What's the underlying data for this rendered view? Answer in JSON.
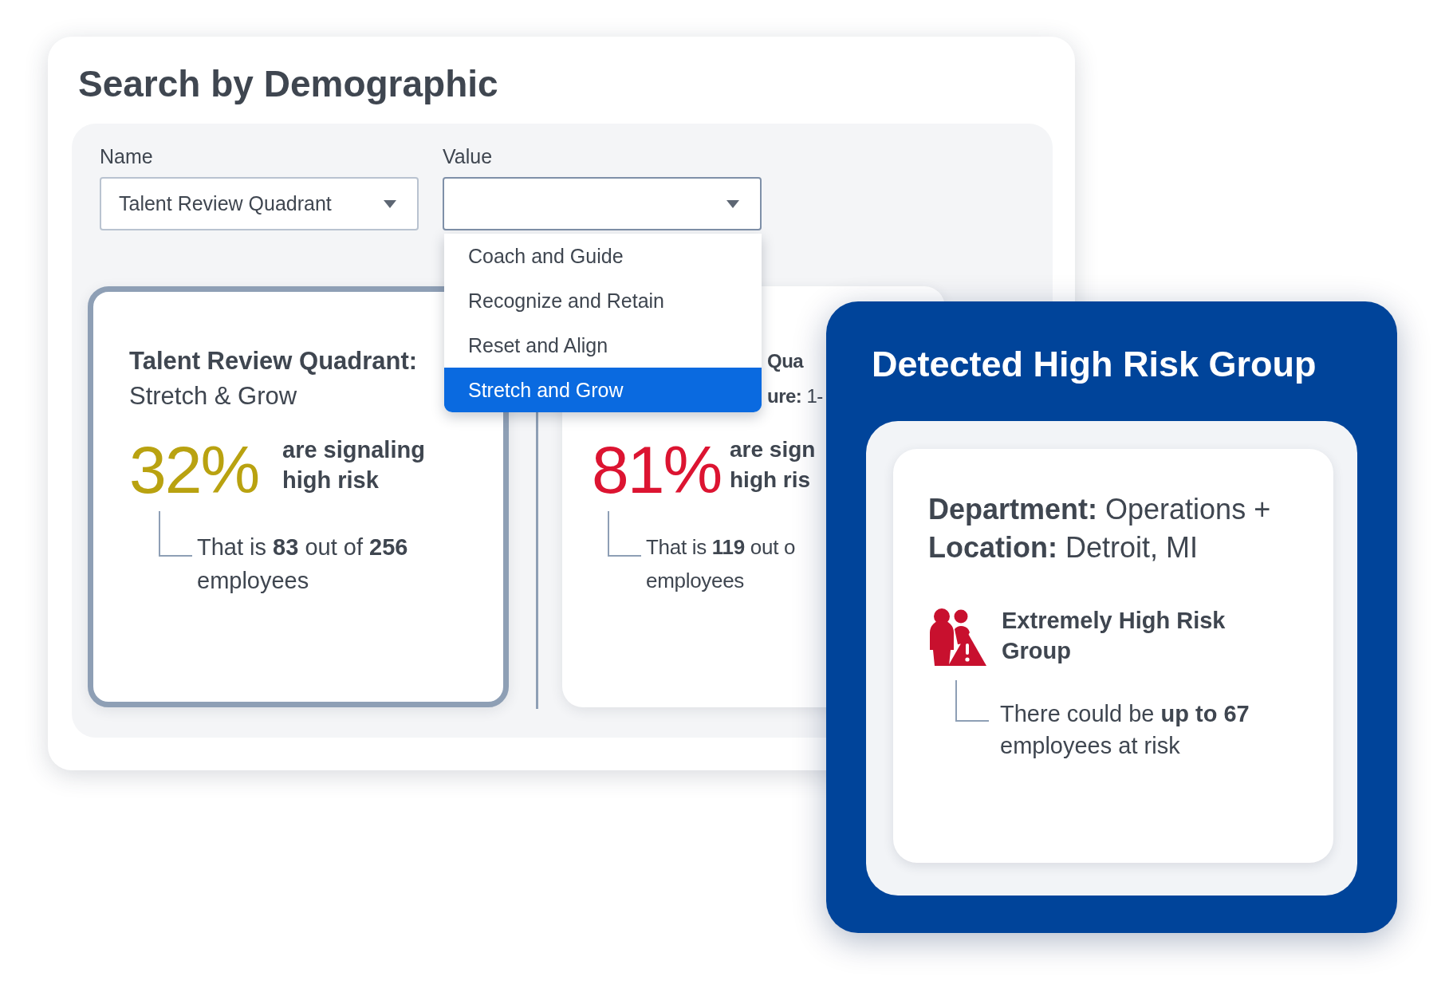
{
  "main_panel": {
    "title": "Search by Demographic",
    "filters": [
      {
        "label": "Name",
        "value": "Talent Review Quadrant",
        "open": false
      },
      {
        "label": "Value",
        "open": true
      }
    ],
    "dropdown_options": [
      {
        "label": "Coach and Guide",
        "selected": false
      },
      {
        "label": "Recognize and Retain",
        "selected": false
      },
      {
        "label": "Reset and Align",
        "selected": false
      },
      {
        "label": "Stretch and Grow",
        "selected": true
      }
    ],
    "cards": [
      {
        "title": "Talent Review Quadrant:",
        "subtitle": "Stretch & Grow",
        "percent": "32%",
        "color": "#b9a210",
        "signal_lines": [
          "are signaling",
          "high risk"
        ],
        "detail_lines": [
          "That is **83** out of **256**",
          "employees"
        ],
        "selected": true
      },
      {
        "title": "Qua",
        "subtitle": "**ure:** 1-",
        "percent": "81%",
        "color": "#dc1431",
        "signal_lines": [
          "are sign",
          "high ris"
        ],
        "detail_lines": [
          "That is **119** out o",
          "employees"
        ],
        "selected": false
      }
    ]
  },
  "risk_panel": {
    "title": "Detected High Risk Group",
    "segment": "**Department:** Operations + **Location:** Detroit, MI",
    "group_label": "Extremely High Risk Group",
    "detail": "There could be **up to 67** employees at risk"
  }
}
